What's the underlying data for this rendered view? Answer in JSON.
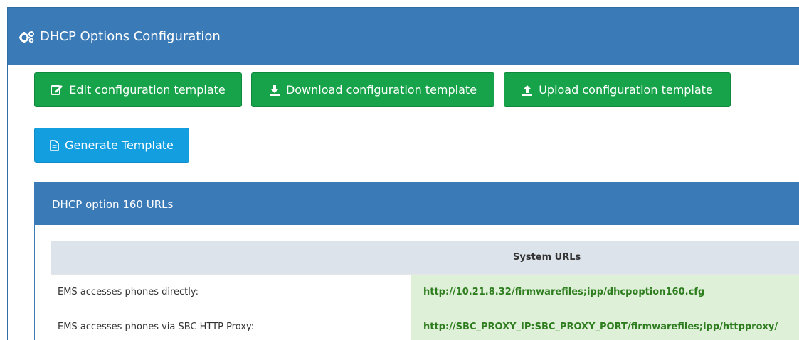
{
  "header": {
    "title": "DHCP Options Configuration",
    "icon": "gears-icon"
  },
  "buttons": {
    "edit": {
      "label": "Edit configuration template",
      "icon": "edit-icon"
    },
    "download": {
      "label": "Download configuration template",
      "icon": "download-icon"
    },
    "upload": {
      "label": "Upload configuration template",
      "icon": "upload-icon"
    },
    "generate": {
      "label": "Generate Template",
      "icon": "file-icon"
    }
  },
  "option160": {
    "title": "DHCP option 160 URLs",
    "table": {
      "header": "System URLs",
      "rows": [
        {
          "label": "EMS accesses phones directly:",
          "url": "http://10.21.8.32/firmwarefiles;ipp/dhcpoption160.cfg"
        },
        {
          "label": "EMS accesses phones via SBC HTTP Proxy:",
          "url": "http://SBC_PROXY_IP:SBC_PROXY_PORT/firmwarefiles;ipp/httpproxy/"
        }
      ]
    }
  },
  "colors": {
    "header_blue": "#3a7ab7",
    "green_button": "#16a34a",
    "blue_button": "#139ee0",
    "url_bg": "#dff0d8",
    "url_text": "#2e7d1f"
  }
}
